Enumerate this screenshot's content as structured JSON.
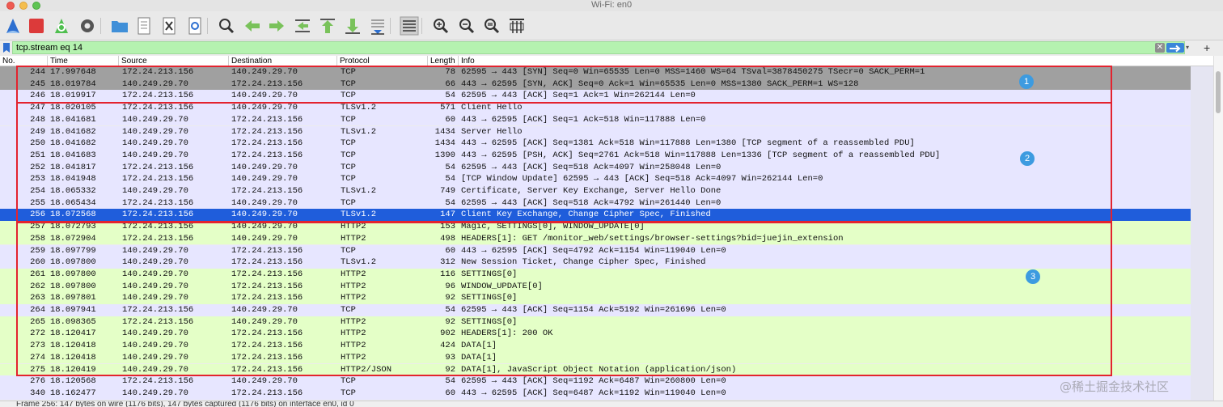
{
  "window": {
    "title": "Wi-Fi: en0"
  },
  "toolbar": {
    "buttons": [
      {
        "name": "start-capture-icon",
        "label": "Start capture"
      },
      {
        "name": "stop-capture-icon",
        "label": "Stop capture"
      },
      {
        "name": "restart-capture-icon",
        "label": "Restart capture"
      },
      {
        "name": "capture-options-icon",
        "label": "Capture options"
      },
      {
        "name": "open-file-icon",
        "label": "Open"
      },
      {
        "name": "save-file-icon",
        "label": "Save"
      },
      {
        "name": "close-file-icon",
        "label": "Close"
      },
      {
        "name": "reload-file-icon",
        "label": "Reload"
      },
      {
        "name": "find-packet-icon",
        "label": "Find packet"
      },
      {
        "name": "go-back-icon",
        "label": "Back"
      },
      {
        "name": "go-forward-icon",
        "label": "Forward"
      },
      {
        "name": "go-to-packet-icon",
        "label": "Go to packet"
      },
      {
        "name": "go-first-icon",
        "label": "First packet"
      },
      {
        "name": "go-last-icon",
        "label": "Last packet"
      },
      {
        "name": "autoscroll-icon",
        "label": "Auto scroll"
      },
      {
        "name": "colorize-icon",
        "label": "Colorize"
      },
      {
        "name": "zoom-in-icon",
        "label": "Zoom in"
      },
      {
        "name": "zoom-out-icon",
        "label": "Zoom out"
      },
      {
        "name": "zoom-reset-icon",
        "label": "Normal size"
      },
      {
        "name": "resize-columns-icon",
        "label": "Resize columns"
      }
    ]
  },
  "filter": {
    "value": "tcp.stream eq 14"
  },
  "columns": [
    "No.",
    "Time",
    "Source",
    "Destination",
    "Protocol",
    "Length",
    "Info"
  ],
  "packets": [
    {
      "no": "244",
      "time": "17.997648",
      "src": "172.24.213.156",
      "dst": "140.249.29.70",
      "proto": "TCP",
      "len": "78",
      "info": "62595 → 443 [SYN] Seq=0 Win=65535 Len=0 MSS=1460 WS=64 TSval=3878450275 TSecr=0 SACK_PERM=1",
      "bg": "#a0a0a0"
    },
    {
      "no": "245",
      "time": "18.019784",
      "src": "140.249.29.70",
      "dst": "172.24.213.156",
      "proto": "TCP",
      "len": "66",
      "info": "443 → 62595 [SYN, ACK] Seq=0 Ack=1 Win=65535 Len=0 MSS=1380 SACK_PERM=1 WS=128",
      "bg": "#a0a0a0"
    },
    {
      "no": "246",
      "time": "18.019917",
      "src": "172.24.213.156",
      "dst": "140.249.29.70",
      "proto": "TCP",
      "len": "54",
      "info": "62595 → 443 [ACK] Seq=1 Ack=1 Win=262144 Len=0",
      "bg": "#e7e6ff"
    },
    {
      "no": "247",
      "time": "18.020105",
      "src": "172.24.213.156",
      "dst": "140.249.29.70",
      "proto": "TLSv1.2",
      "len": "571",
      "info": "Client Hello",
      "bg": "#e7e6ff"
    },
    {
      "no": "248",
      "time": "18.041681",
      "src": "140.249.29.70",
      "dst": "172.24.213.156",
      "proto": "TCP",
      "len": "60",
      "info": "443 → 62595 [ACK] Seq=1 Ack=518 Win=117888 Len=0",
      "bg": "#e7e6ff"
    },
    {
      "no": "249",
      "time": "18.041682",
      "src": "140.249.29.70",
      "dst": "172.24.213.156",
      "proto": "TLSv1.2",
      "len": "1434",
      "info": "Server Hello",
      "bg": "#e7e6ff"
    },
    {
      "no": "250",
      "time": "18.041682",
      "src": "140.249.29.70",
      "dst": "172.24.213.156",
      "proto": "TCP",
      "len": "1434",
      "info": "443 → 62595 [ACK] Seq=1381 Ack=518 Win=117888 Len=1380 [TCP segment of a reassembled PDU]",
      "bg": "#e7e6ff"
    },
    {
      "no": "251",
      "time": "18.041683",
      "src": "140.249.29.70",
      "dst": "172.24.213.156",
      "proto": "TCP",
      "len": "1390",
      "info": "443 → 62595 [PSH, ACK] Seq=2761 Ack=518 Win=117888 Len=1336 [TCP segment of a reassembled PDU]",
      "bg": "#e7e6ff"
    },
    {
      "no": "252",
      "time": "18.041817",
      "src": "172.24.213.156",
      "dst": "140.249.29.70",
      "proto": "TCP",
      "len": "54",
      "info": "62595 → 443 [ACK] Seq=518 Ack=4097 Win=258048 Len=0",
      "bg": "#e7e6ff"
    },
    {
      "no": "253",
      "time": "18.041948",
      "src": "172.24.213.156",
      "dst": "140.249.29.70",
      "proto": "TCP",
      "len": "54",
      "info": "[TCP Window Update] 62595 → 443 [ACK] Seq=518 Ack=4097 Win=262144 Len=0",
      "bg": "#e7e6ff"
    },
    {
      "no": "254",
      "time": "18.065332",
      "src": "140.249.29.70",
      "dst": "172.24.213.156",
      "proto": "TLSv1.2",
      "len": "749",
      "info": "Certificate, Server Key Exchange, Server Hello Done",
      "bg": "#e7e6ff"
    },
    {
      "no": "255",
      "time": "18.065434",
      "src": "172.24.213.156",
      "dst": "140.249.29.70",
      "proto": "TCP",
      "len": "54",
      "info": "62595 → 443 [ACK] Seq=518 Ack=4792 Win=261440 Len=0",
      "bg": "#e7e6ff"
    },
    {
      "no": "256",
      "time": "18.072568",
      "src": "172.24.213.156",
      "dst": "140.249.29.70",
      "proto": "TLSv1.2",
      "len": "147",
      "info": "Client Key Exchange, Change Cipher Spec, Finished",
      "bg": "#1f5ddb",
      "selected": true
    },
    {
      "no": "257",
      "time": "18.072793",
      "src": "172.24.213.156",
      "dst": "140.249.29.70",
      "proto": "HTTP2",
      "len": "153",
      "info": "Magic, SETTINGS[0], WINDOW_UPDATE[0]",
      "bg": "#e4ffc7"
    },
    {
      "no": "258",
      "time": "18.072904",
      "src": "172.24.213.156",
      "dst": "140.249.29.70",
      "proto": "HTTP2",
      "len": "498",
      "info": "HEADERS[1]: GET /monitor_web/settings/browser-settings?bid=juejin_extension",
      "bg": "#e4ffc7"
    },
    {
      "no": "259",
      "time": "18.097799",
      "src": "140.249.29.70",
      "dst": "172.24.213.156",
      "proto": "TCP",
      "len": "60",
      "info": "443 → 62595 [ACK] Seq=4792 Ack=1154 Win=119040 Len=0",
      "bg": "#e7e6ff"
    },
    {
      "no": "260",
      "time": "18.097800",
      "src": "140.249.29.70",
      "dst": "172.24.213.156",
      "proto": "TLSv1.2",
      "len": "312",
      "info": "New Session Ticket, Change Cipher Spec, Finished",
      "bg": "#e7e6ff"
    },
    {
      "no": "261",
      "time": "18.097800",
      "src": "140.249.29.70",
      "dst": "172.24.213.156",
      "proto": "HTTP2",
      "len": "116",
      "info": "SETTINGS[0]",
      "bg": "#e4ffc7"
    },
    {
      "no": "262",
      "time": "18.097800",
      "src": "140.249.29.70",
      "dst": "172.24.213.156",
      "proto": "HTTP2",
      "len": "96",
      "info": "WINDOW_UPDATE[0]",
      "bg": "#e4ffc7"
    },
    {
      "no": "263",
      "time": "18.097801",
      "src": "140.249.29.70",
      "dst": "172.24.213.156",
      "proto": "HTTP2",
      "len": "92",
      "info": "SETTINGS[0]",
      "bg": "#e4ffc7"
    },
    {
      "no": "264",
      "time": "18.097941",
      "src": "172.24.213.156",
      "dst": "140.249.29.70",
      "proto": "TCP",
      "len": "54",
      "info": "62595 → 443 [ACK] Seq=1154 Ack=5192 Win=261696 Len=0",
      "bg": "#e7e6ff"
    },
    {
      "no": "265",
      "time": "18.098365",
      "src": "172.24.213.156",
      "dst": "140.249.29.70",
      "proto": "HTTP2",
      "len": "92",
      "info": "SETTINGS[0]",
      "bg": "#e4ffc7"
    },
    {
      "no": "272",
      "time": "18.120417",
      "src": "140.249.29.70",
      "dst": "172.24.213.156",
      "proto": "HTTP2",
      "len": "902",
      "info": "HEADERS[1]: 200 OK",
      "bg": "#e4ffc7"
    },
    {
      "no": "273",
      "time": "18.120418",
      "src": "140.249.29.70",
      "dst": "172.24.213.156",
      "proto": "HTTP2",
      "len": "424",
      "info": "DATA[1]",
      "bg": "#e4ffc7"
    },
    {
      "no": "274",
      "time": "18.120418",
      "src": "140.249.29.70",
      "dst": "172.24.213.156",
      "proto": "HTTP2",
      "len": "93",
      "info": "DATA[1]",
      "bg": "#e4ffc7"
    },
    {
      "no": "275",
      "time": "18.120419",
      "src": "140.249.29.70",
      "dst": "172.24.213.156",
      "proto": "HTTP2/JSON",
      "len": "92",
      "info": "DATA[1], JavaScript Object Notation (application/json)",
      "bg": "#e4ffc7"
    },
    {
      "no": "276",
      "time": "18.120568",
      "src": "172.24.213.156",
      "dst": "140.249.29.70",
      "proto": "TCP",
      "len": "54",
      "info": "62595 → 443 [ACK] Seq=1192 Ack=6487 Win=260800 Len=0",
      "bg": "#e7e6ff"
    },
    {
      "no": "340",
      "time": "18.162477",
      "src": "140.249.29.70",
      "dst": "172.24.213.156",
      "proto": "TCP",
      "len": "60",
      "info": "443 → 62595 [ACK] Seq=6487 Ack=1192 Win=119040 Len=0",
      "bg": "#e7e6ff"
    }
  ],
  "annotations": [
    "1",
    "2",
    "3"
  ],
  "status": {
    "text": "Frame 256: 147 bytes on wire (1176 bits), 147 bytes captured (1176 bits) on interface en0, id 0"
  },
  "watermark": "@稀土掘金技术社区"
}
